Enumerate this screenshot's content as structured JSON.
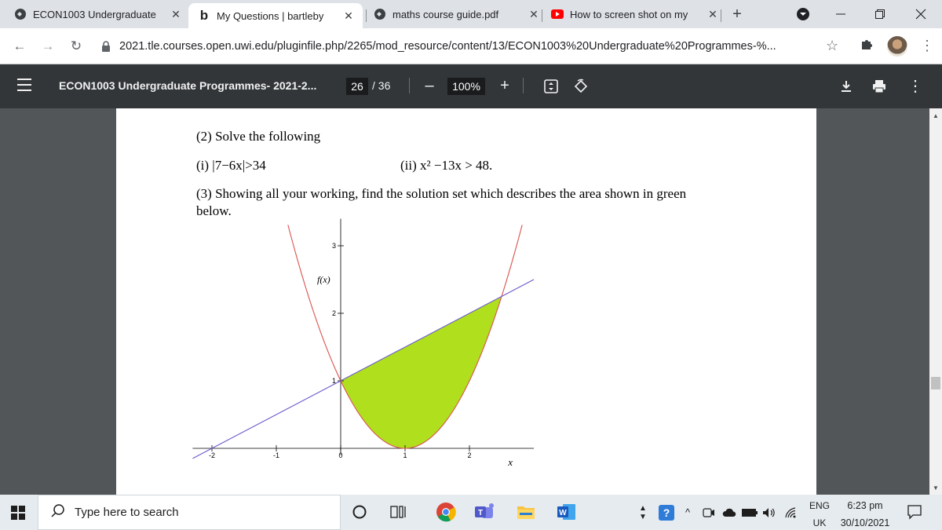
{
  "browser": {
    "tabs": [
      {
        "title": "ECON1003 Undergraduate",
        "active": false,
        "icon": "globe-icon"
      },
      {
        "title": "My Questions | bartleby",
        "active": true,
        "icon": "bartleby-b-icon"
      },
      {
        "title": "maths course guide.pdf",
        "active": false,
        "icon": "globe-icon"
      },
      {
        "title": "How to screen shot on my",
        "active": false,
        "icon": "youtube-icon"
      }
    ],
    "url": "2021.tle.courses.open.uwi.edu/pluginfile.php/2265/mod_resource/content/13/ECON1003%20Undergraduate%20Programmes-%..."
  },
  "pdf_toolbar": {
    "title": "ECON1003 Undergraduate Programmes- 2021-2...",
    "page_current": "26",
    "page_total": "/ 36",
    "zoom": "100%"
  },
  "document": {
    "q2_heading": "(2) Solve the following",
    "q2_i": "(i) |7−6x|>34",
    "q2_ii": "(ii) x² −13x > 48.",
    "q3_line1": "(3) Showing all your working, find the solution set which describes the area shown in green",
    "q3_line2": "below."
  },
  "chart_data": {
    "type": "area",
    "title": "",
    "xlabel": "x",
    "ylabel": "f(x)",
    "xlim": [
      -2.3,
      3.0
    ],
    "ylim": [
      -0.1,
      3.4
    ],
    "x_ticks": [
      "-2",
      "-1",
      "0",
      "1",
      "2"
    ],
    "y_ticks": [
      "1",
      "2",
      "3"
    ],
    "series": [
      {
        "kind": "parabola",
        "equation": "y=(x-1)^2",
        "color": "#d9534f"
      },
      {
        "kind": "line",
        "equation": "y=0.5x+1",
        "color": "#6a5acd"
      }
    ],
    "shaded_region": {
      "from_x": 0,
      "to_x": 2.5,
      "between": [
        "y=0.5x+1",
        "y=(x-1)^2"
      ],
      "color": "#b0e01d"
    }
  },
  "taskbar": {
    "search_placeholder": "Type here to search",
    "lang_top": "ENG",
    "lang_bottom": "UK",
    "time": "6:23 pm",
    "date": "30/10/2021"
  }
}
